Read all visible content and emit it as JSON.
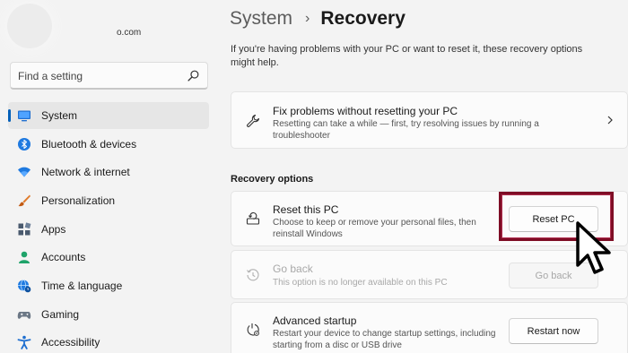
{
  "account": {
    "email_suffix": "o.com"
  },
  "search": {
    "placeholder": "Find a setting",
    "value": ""
  },
  "sidebar": {
    "items": [
      {
        "label": "System",
        "icon": "monitor-icon",
        "active": true
      },
      {
        "label": "Bluetooth & devices",
        "icon": "bluetooth-icon"
      },
      {
        "label": "Network & internet",
        "icon": "wifi-icon"
      },
      {
        "label": "Personalization",
        "icon": "paintbrush-icon"
      },
      {
        "label": "Apps",
        "icon": "apps-icon"
      },
      {
        "label": "Accounts",
        "icon": "person-icon"
      },
      {
        "label": "Time & language",
        "icon": "globe-clock-icon"
      },
      {
        "label": "Gaming",
        "icon": "gamepad-icon"
      },
      {
        "label": "Accessibility",
        "icon": "accessibility-icon"
      }
    ]
  },
  "header": {
    "parent": "System",
    "separator": "›",
    "current": "Recovery"
  },
  "intro": "If you're having problems with your PC or want to reset it, these recovery options might help.",
  "fix_card": {
    "title": "Fix problems without resetting your PC",
    "description_line1": "Resetting can take a while — first, try resolving issues by running a",
    "description_line2": "troubleshooter",
    "icon": "wrench-icon"
  },
  "section": {
    "recovery_options": "Recovery options"
  },
  "options": {
    "reset": {
      "title": "Reset this PC",
      "description_line1": "Choose to keep or remove your personal files, then",
      "description_line2": "reinstall Windows",
      "button": "Reset PC",
      "icon": "reset-pc-icon"
    },
    "goback": {
      "title": "Go back",
      "description": "This option is no longer available on this PC",
      "button": "Go back",
      "disabled": true,
      "icon": "history-icon"
    },
    "advanced": {
      "title": "Advanced startup",
      "description_line1": "Restart your device to change startup settings, including",
      "description_line2": "starting from a disc or USB drive",
      "button": "Restart now",
      "icon": "advanced-startup-icon"
    }
  },
  "colors": {
    "accent": "#005fb8",
    "highlight": "#7e0d25",
    "background": "#f3f3f3",
    "card": "#fbfbfb"
  }
}
